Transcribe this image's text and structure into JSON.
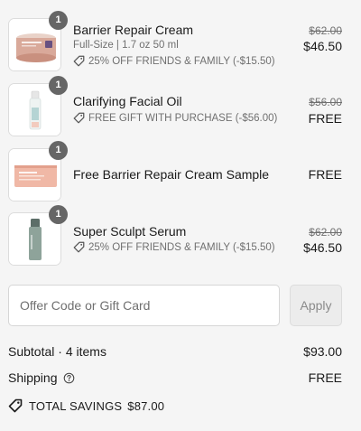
{
  "items": [
    {
      "quantity": "1",
      "name": "Barrier Repair Cream",
      "variant": "Full-Size | 1.7 oz 50 ml",
      "discount": "25% OFF FRIENDS & FAMILY (-$15.50)",
      "original_price": "$62.00",
      "price": "$46.50",
      "image": "pink-cream-jar"
    },
    {
      "quantity": "1",
      "name": "Clarifying Facial Oil",
      "discount": "FREE GIFT WITH PURCHASE (-$56.00)",
      "original_price": "$56.00",
      "price": "FREE",
      "image": "clear-oil-bottle"
    },
    {
      "quantity": "1",
      "name": "Free Barrier Repair Cream Sample",
      "price": "FREE",
      "image": "pink-sample-sachet"
    },
    {
      "quantity": "1",
      "name": "Super Sculpt Serum",
      "discount": "25% OFF FRIENDS & FAMILY (-$15.50)",
      "original_price": "$62.00",
      "price": "$46.50",
      "image": "green-serum-bottle"
    }
  ],
  "promo": {
    "placeholder": "Offer Code or Gift Card",
    "apply_label": "Apply"
  },
  "summary": {
    "subtotal_label": "Subtotal · 4 items",
    "subtotal_value": "$93.00",
    "shipping_label": "Shipping",
    "shipping_value": "FREE",
    "savings_label": "TOTAL SAVINGS",
    "savings_value": "$87.00"
  },
  "colors": {
    "background": "#f5f5f5",
    "badge": "#666666",
    "muted_text": "#707070"
  }
}
